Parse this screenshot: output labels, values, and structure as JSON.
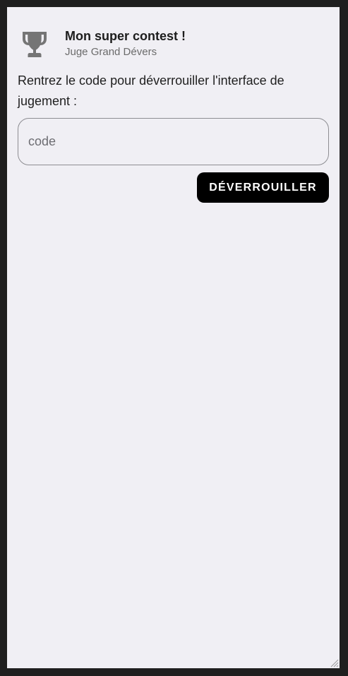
{
  "header": {
    "icon": "trophy-icon",
    "title": "Mon super contest !",
    "subtitle": "Juge Grand Dévers"
  },
  "prompt": {
    "text": "Rentrez le code pour déverrouiller l'interface de jugement :"
  },
  "code_field": {
    "value": "",
    "placeholder": "code"
  },
  "unlock_button": {
    "label": "DÉVERROUILLER"
  },
  "colors": {
    "background": "#f0eff4",
    "frame": "#1f1f1f",
    "button": "#000000",
    "icon": "#757575"
  }
}
